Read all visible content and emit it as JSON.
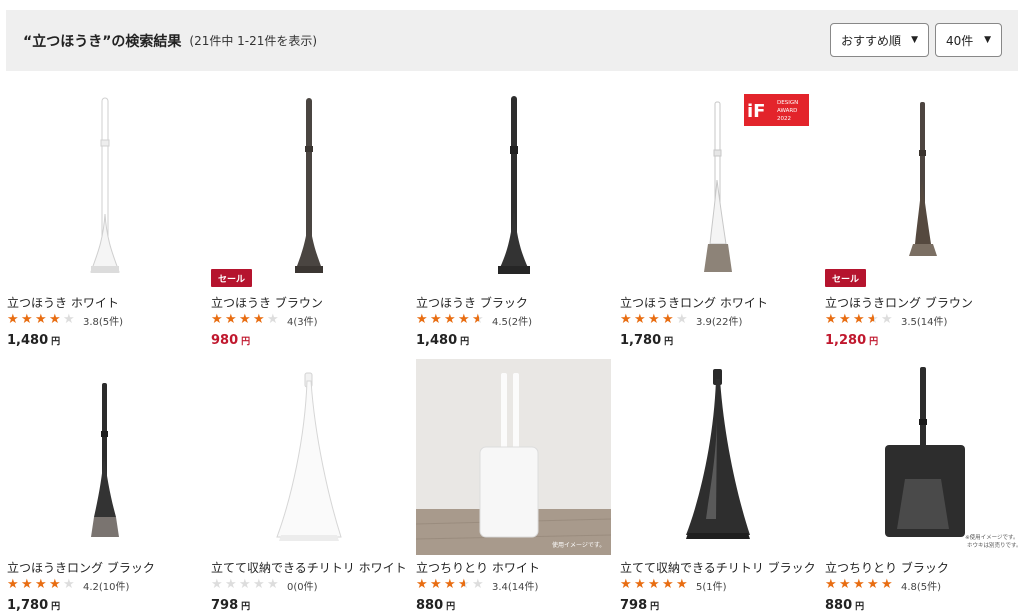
{
  "header": {
    "search_title": "“立つほうき”の検索結果",
    "result_count": "(21件中 1-21件を表示)",
    "sort_label": "おすすめ順",
    "per_page_label": "40件"
  },
  "colors": {
    "star_on": "#e86d12",
    "star_off": "#dddddd",
    "sale": "#c0182e"
  },
  "award": {
    "line1": "iF",
    "line2": "DESIGN",
    "line3": "AWARD",
    "line4": "2022"
  },
  "image_notes": {
    "p8": "使用イメージです。",
    "p10_line1": "※使用イメージです。",
    "p10_line2": "ホウキは別売りです。"
  },
  "products": [
    {
      "name": "立つほうき ホワイト",
      "rating": 3.8,
      "rating_text": "3.8(5件)",
      "price": "1,480",
      "yen": "円",
      "sale": false,
      "image": "broom-white"
    },
    {
      "name": "立つほうき ブラウン",
      "rating": 4,
      "rating_text": "4(3件)",
      "price": "980",
      "yen": "円",
      "sale": true,
      "sale_label": "セール",
      "image": "broom-brown"
    },
    {
      "name": "立つほうき ブラック",
      "rating": 4.5,
      "rating_text": "4.5(2件)",
      "price": "1,480",
      "yen": "円",
      "sale": false,
      "image": "broom-black"
    },
    {
      "name": "立つほうきロング ホワイト",
      "rating": 3.9,
      "rating_text": "3.9(22件)",
      "price": "1,780",
      "yen": "円",
      "sale": false,
      "image": "long-broom-white",
      "award": true
    },
    {
      "name": "立つほうきロング ブラウン",
      "rating": 3.5,
      "rating_text": "3.5(14件)",
      "price": "1,280",
      "yen": "円",
      "sale": true,
      "sale_label": "セール",
      "image": "long-broom-brown"
    },
    {
      "name": "立つほうきロング ブラック",
      "rating": 4.2,
      "rating_text": "4.2(10件)",
      "price": "1,780",
      "yen": "円",
      "sale": false,
      "image": "long-broom-black"
    },
    {
      "name": "立てて収納できるチリトリ ホワイト",
      "rating": 0,
      "rating_text": "0(0件)",
      "price": "798",
      "yen": "円",
      "sale": false,
      "image": "dustpan-white"
    },
    {
      "name": "立つちりとり ホワイト",
      "rating": 3.4,
      "rating_text": "3.4(14件)",
      "price": "880",
      "yen": "円",
      "sale": false,
      "image": "dustpan-stand-white"
    },
    {
      "name": "立てて収納できるチリトリ ブラック",
      "rating": 5,
      "rating_text": "5(1件)",
      "price": "798",
      "yen": "円",
      "sale": false,
      "image": "dustpan-black"
    },
    {
      "name": "立つちりとり ブラック",
      "rating": 4.8,
      "rating_text": "4.8(5件)",
      "price": "880",
      "yen": "円",
      "sale": false,
      "image": "dustpan-stand-black"
    }
  ]
}
